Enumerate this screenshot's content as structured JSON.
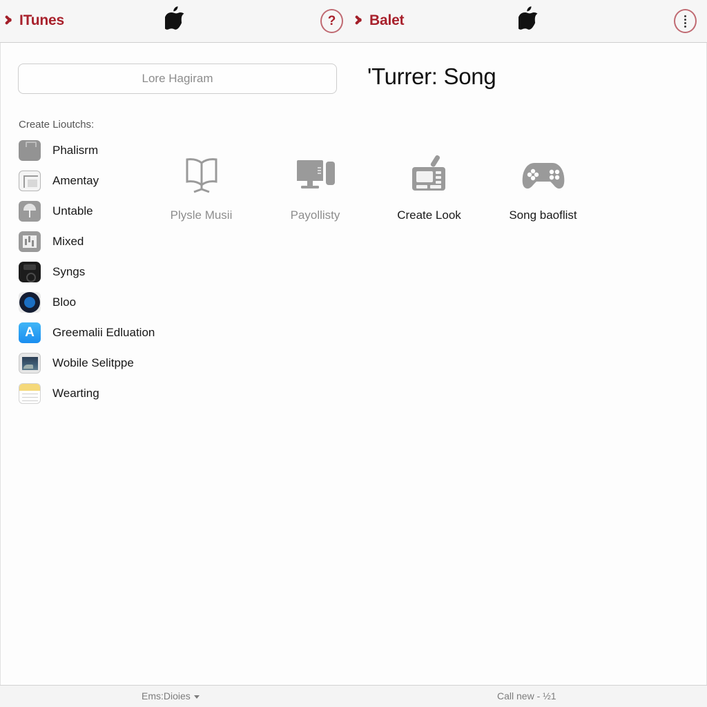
{
  "header": {
    "back_itunes": {
      "label": "ITunes",
      "icon": "back-chevron-icon"
    },
    "apple_logo_left": "apple-logo-icon",
    "help_button": {
      "label": "?",
      "icon": "question-mark-circle-icon"
    },
    "back_balet": {
      "label": "Balet",
      "icon": "back-chevron-icon"
    },
    "apple_logo_right": "apple-logo-icon",
    "more_button": {
      "icon": "vertical-dots-circle-icon"
    },
    "accent_color": "#a8212c",
    "background_color": "#f6f6f6"
  },
  "main": {
    "search": {
      "placeholder": "Lore Hagiram",
      "value": ""
    },
    "page_title": "'Turrer: Song",
    "sidebar": {
      "heading": "Create Lioutchs:",
      "items": [
        {
          "label": "Phalisrm",
          "icon": "briefcase-icon",
          "icon_class": "ic-bag"
        },
        {
          "label": "Amentay",
          "icon": "window-icon",
          "icon_class": "ic-win"
        },
        {
          "label": "Untable",
          "icon": "umbrella-icon",
          "icon_class": "ic-umb"
        },
        {
          "label": "Mixed",
          "icon": "bar-chart-icon",
          "icon_class": "ic-chart"
        },
        {
          "label": "Syngs",
          "icon": "remote-control-icon",
          "icon_class": "ic-remote"
        },
        {
          "label": "Bloo",
          "icon": "compass-icon",
          "icon_class": "ic-bloo"
        },
        {
          "label": "Greemalii Edluation",
          "icon": "app-store-icon",
          "icon_class": "ic-appstore"
        },
        {
          "label": "Wobile Selitppe",
          "icon": "photo-icon",
          "icon_class": "ic-photo"
        },
        {
          "label": "Wearting",
          "icon": "notes-icon",
          "icon_class": "ic-notes"
        }
      ]
    },
    "tiles": [
      {
        "label": "Plysle Musii",
        "icon": "open-book-icon",
        "label_style": "muted"
      },
      {
        "label": "Payollisty",
        "icon": "desktop-computer-icon",
        "label_style": "muted"
      },
      {
        "label": "Create Look",
        "icon": "drawing-tablet-icon",
        "label_style": "dark"
      },
      {
        "label": "Song baoflist",
        "icon": "game-controller-icon",
        "label_style": "dark"
      }
    ]
  },
  "footer": {
    "left": "Ems:Dioies",
    "right": "Call new - ½1"
  }
}
